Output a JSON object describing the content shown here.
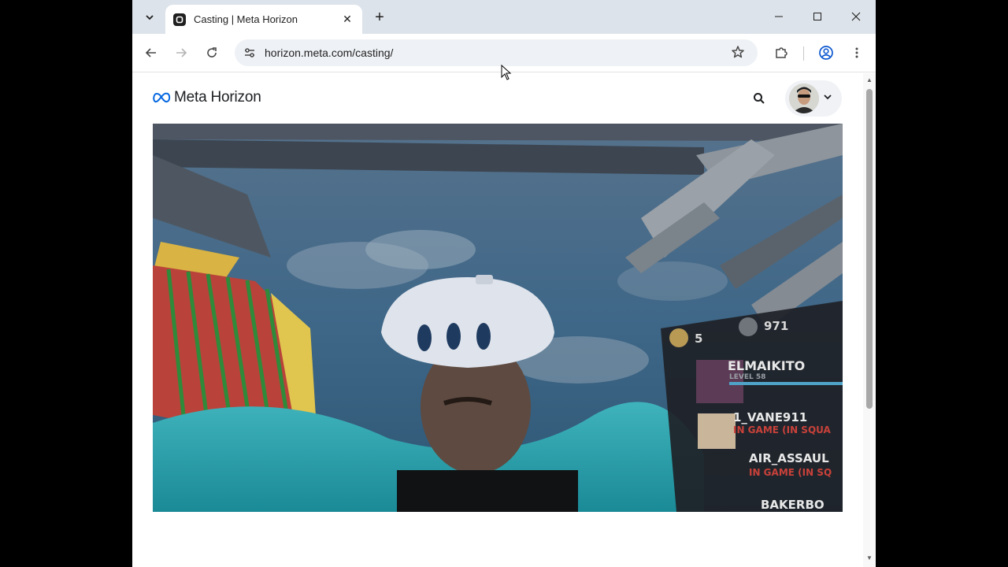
{
  "browser": {
    "tab_title": "Casting | Meta Horizon",
    "url": "horizon.meta.com/casting/",
    "new_tab_symbol": "+",
    "close_tab_symbol": "✕"
  },
  "site": {
    "logo_text": "Meta Horizon",
    "accent": "#0668E1"
  },
  "cast_hud": {
    "coins": "5",
    "points": "971",
    "players": [
      {
        "name": "ELMAIKITO",
        "status": "LEVEL 58"
      },
      {
        "name": "1_VANE911",
        "status": "IN GAME (IN SQUA"
      },
      {
        "name": "AIR_ASSAUL",
        "status": "IN GAME (IN SQ"
      },
      {
        "name": "BAKERBO",
        "status": ""
      }
    ]
  },
  "icons": {
    "tab_list": "chevron-down-icon",
    "back": "arrow-left-icon",
    "forward": "arrow-right-icon",
    "reload": "reload-icon",
    "site_info": "tune-icon",
    "bookmark": "star-icon",
    "extensions": "puzzle-icon",
    "profile": "account-circle-icon",
    "menu": "kebab-icon",
    "search": "search-icon"
  }
}
